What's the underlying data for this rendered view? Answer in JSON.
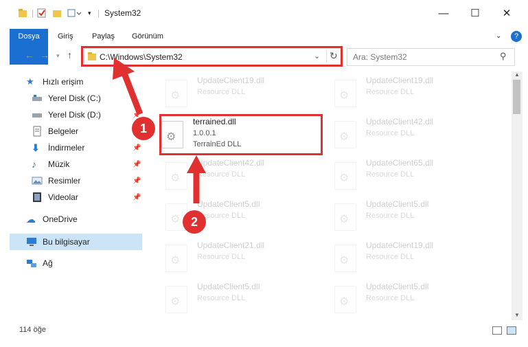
{
  "window": {
    "title": "System32"
  },
  "ribbon": {
    "tabs": [
      "Dosya",
      "Giriş",
      "Paylaş",
      "Görünüm"
    ]
  },
  "address": {
    "path": "C:\\Windows\\System32"
  },
  "search": {
    "placeholder": "Ara: System32"
  },
  "sidebar": {
    "items": [
      {
        "label": "Hızlı erişim",
        "icon": "star-icon"
      },
      {
        "label": "Yerel Disk (C:)",
        "icon": "drive-icon"
      },
      {
        "label": "Yerel Disk (D:)",
        "icon": "drive-icon"
      },
      {
        "label": "Belgeler",
        "icon": "document-icon"
      },
      {
        "label": "İndirmeler",
        "icon": "download-icon"
      },
      {
        "label": "Müzik",
        "icon": "music-icon"
      },
      {
        "label": "Resimler",
        "icon": "pictures-icon"
      },
      {
        "label": "Videolar",
        "icon": "video-icon"
      },
      {
        "label": "OneDrive",
        "icon": "cloud-icon"
      },
      {
        "label": "Bu bilgisayar",
        "icon": "computer-icon"
      },
      {
        "label": "Ağ",
        "icon": "network-icon"
      }
    ]
  },
  "files": {
    "main": {
      "name": "terrained.dll",
      "version": "1.0.0.1",
      "desc": "TerrainEd DLL"
    },
    "ghosts": [
      {
        "name": "UpdateClient19.dll",
        "desc": "Resource DLL"
      },
      {
        "name": "UpdateClient19.dll",
        "desc": "Resource DLL"
      },
      {
        "name": "UpdateClient42.dll",
        "desc": "Resource DLL"
      },
      {
        "name": "UpdateClient42.dll",
        "desc": "Resource DLL"
      },
      {
        "name": "UpdateClient65.dll",
        "desc": "Resource DLL"
      },
      {
        "name": "UpdateClient5.dll",
        "desc": "Resource DLL"
      },
      {
        "name": "UpdateClient5.dll",
        "desc": "Resource DLL"
      },
      {
        "name": "UpdateClient21.dll",
        "desc": "Resource DLL"
      },
      {
        "name": "UpdateClient19.dll",
        "desc": "Resource DLL"
      },
      {
        "name": "UpdateClient5.dll",
        "desc": "Resource DLL"
      },
      {
        "name": "UpdateClient5.dll",
        "desc": "Resource DLL"
      }
    ]
  },
  "annotations": {
    "badge1": "1",
    "badge2": "2"
  },
  "status": {
    "count": "114 öğe"
  },
  "colors": {
    "accent": "#1a6fd0",
    "highlight": "#e03030",
    "selection": "#cce4f7"
  }
}
